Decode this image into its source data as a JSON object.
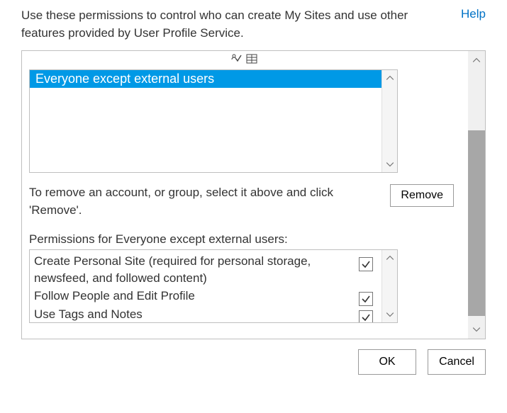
{
  "header": {
    "description": "Use these permissions to control who can create My Sites and use other features provided by User Profile Service.",
    "help_label": "Help"
  },
  "accounts_list": {
    "items": [
      {
        "label": "Everyone except external users",
        "selected": true
      }
    ]
  },
  "remove_instruction": "To remove an account, or group, select it above and click 'Remove'.",
  "remove_button_label": "Remove",
  "permissions_label": "Permissions for Everyone except external users:",
  "permissions": [
    {
      "label": "Create Personal Site (required for personal storage, newsfeed, and followed content)",
      "checked": true
    },
    {
      "label": "Follow People and Edit Profile",
      "checked": true
    },
    {
      "label": "Use Tags and Notes",
      "checked": true
    }
  ],
  "footer": {
    "ok_label": "OK",
    "cancel_label": "Cancel"
  }
}
